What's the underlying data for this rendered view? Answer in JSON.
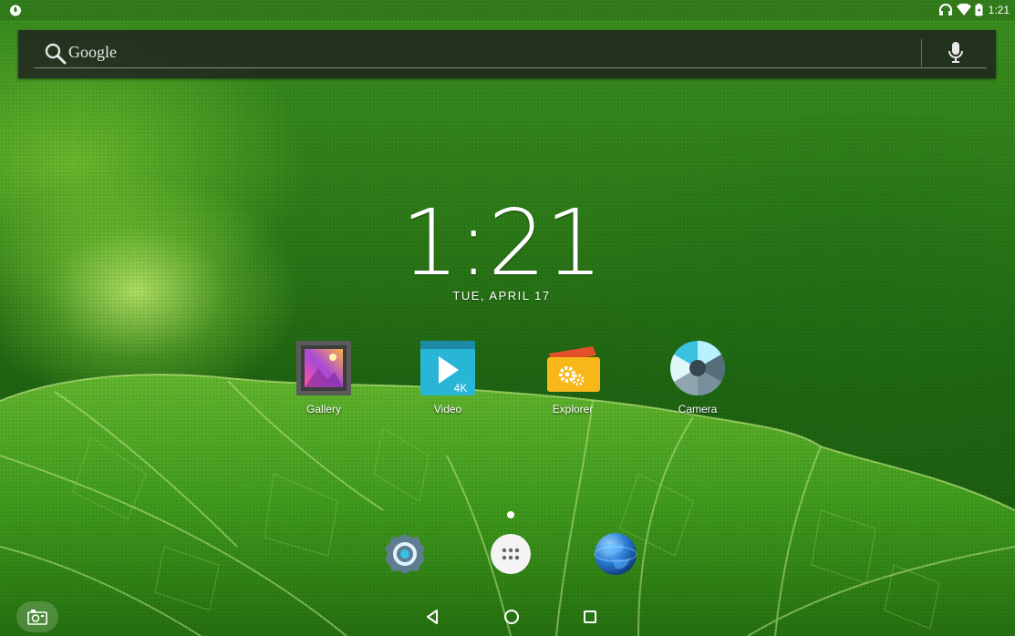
{
  "status_bar": {
    "time": "1:21",
    "icons": [
      "notification-icon",
      "headset-icon",
      "wifi-icon",
      "battery-icon"
    ]
  },
  "search": {
    "label": "Google",
    "icons": [
      "search-icon",
      "mic-icon"
    ]
  },
  "clock": {
    "time": "1:21",
    "date": "TUE, APRIL 17"
  },
  "apps": [
    {
      "label": "Gallery",
      "icon": "gallery-icon"
    },
    {
      "label": "Video",
      "icon": "video-icon",
      "badge": "4K"
    },
    {
      "label": "Explorer",
      "icon": "explorer-icon"
    },
    {
      "label": "Camera",
      "icon": "camera-icon"
    }
  ],
  "dock": {
    "items": [
      "settings-icon",
      "all-apps-icon",
      "browser-icon"
    ]
  },
  "navbar": {
    "items": [
      "back-icon",
      "home-icon",
      "recents-icon",
      "screenshot-icon"
    ]
  }
}
